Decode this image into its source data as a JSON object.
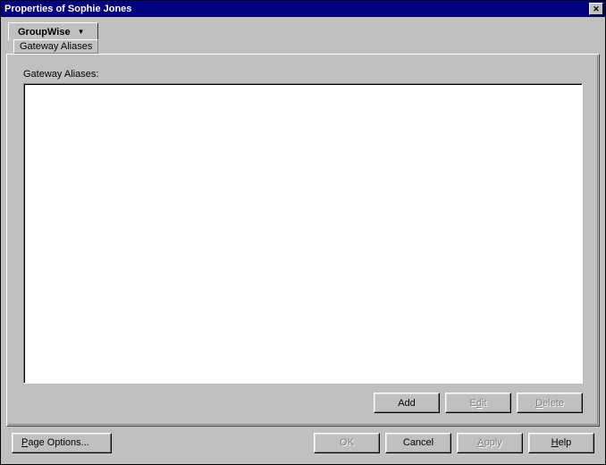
{
  "window": {
    "title": "Properties of Sophie Jones"
  },
  "tabs": {
    "main": "GroupWise",
    "sub": "Gateway Aliases"
  },
  "panel": {
    "label": "Gateway Aliases:",
    "buttons": {
      "add": "Add",
      "edit_pre": "E",
      "edit_u": "d",
      "edit_post": "it",
      "delete_u": "D",
      "delete_post": "elete"
    }
  },
  "bottom": {
    "page_options_u": "P",
    "page_options_post": "age Options...",
    "ok": "OK",
    "cancel": "Cancel",
    "apply_u": "A",
    "apply_post": "pply",
    "help_u": "H",
    "help_post": "elp"
  }
}
